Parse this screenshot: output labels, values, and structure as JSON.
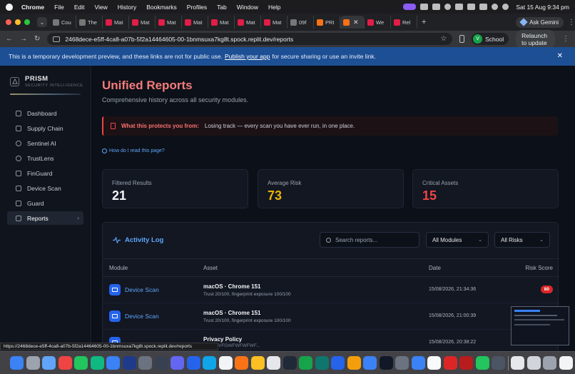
{
  "menubar": {
    "items": [
      "Chrome",
      "File",
      "Edit",
      "View",
      "History",
      "Bookmarks",
      "Profiles",
      "Tab",
      "Window",
      "Help"
    ],
    "clock": "Sat 15 Aug  9:34 pm"
  },
  "tabs": {
    "items": [
      "Cou",
      "The",
      "Mat",
      "Mat",
      "Mat",
      "Mat",
      "Mat",
      "Mat",
      "Mat",
      "09f",
      "PRI",
      "",
      "We",
      "Rel"
    ],
    "ask_gemini": "Ask Gemini"
  },
  "address": {
    "url": "2468dece-e5ff-4ca8-a07b-5f2a14464605-00-1bnmsuxa7kg8t.spock.replit.dev/reports",
    "profile_initial": "V",
    "profile_name": "School",
    "relaunch": "Relaunch to update"
  },
  "banner": {
    "text_before": "This is a temporary development preview, and these links are not for public use.",
    "link": "Publish your app",
    "text_after": "for secure sharing or use an invite link."
  },
  "sidebar": {
    "brand": "PRISM",
    "tagline": "SECURITY INTELLIGENCE",
    "items": [
      {
        "label": "Dashboard"
      },
      {
        "label": "Supply Chain"
      },
      {
        "label": "Sentinel AI"
      },
      {
        "label": "TrustLens"
      },
      {
        "label": "FinGuard"
      },
      {
        "label": "Device Scan"
      },
      {
        "label": "Guard"
      },
      {
        "label": "Reports"
      }
    ]
  },
  "page": {
    "title": "Unified Reports",
    "subtitle": "Comprehensive history across all security modules.",
    "protect_lead": "What this protects you from:",
    "protect_body": "Losing track — every scan you have ever run, in one place.",
    "help_link": "How do I read this page?"
  },
  "stats": {
    "filtered": {
      "label": "Filtered Results",
      "value": "21"
    },
    "average": {
      "label": "Average Risk",
      "value": "73"
    },
    "critical": {
      "label": "Critical Assets",
      "value": "15"
    }
  },
  "activity": {
    "title": "Activity Log",
    "search_placeholder": "Search reports...",
    "module_filter": "All Modules",
    "risk_filter": "All Risks",
    "columns": {
      "module": "Module",
      "asset": "Asset",
      "date": "Date",
      "risk": "Risk Score"
    },
    "rows": [
      {
        "module": "Device Scan",
        "asset": "macOS · Chrome 151",
        "detail": "Trust 20/100, fingerprint exposure 100/100",
        "date": "15/08/2026, 21:34:36",
        "score": "80"
      },
      {
        "module": "Device Scan",
        "asset": "macOS · Chrome 151",
        "detail": "Trust 20/100, fingerprint exposure 100/100",
        "date": "15/08/2026, 21:00:39",
        "score": ""
      },
      {
        "module": "",
        "asset": "Privacy Policy",
        "detail": "",
        "date": "15/08/2026, 20:38:22",
        "score": ""
      }
    ]
  },
  "statusbar": {
    "url": "https://2468dece-e5ff-4ca8-a07b-5f2a14464605-00-1bnmsuxa7kg8t.spock.replit.dev/reports",
    "ghost": "VFGWFWFWFWF..."
  }
}
